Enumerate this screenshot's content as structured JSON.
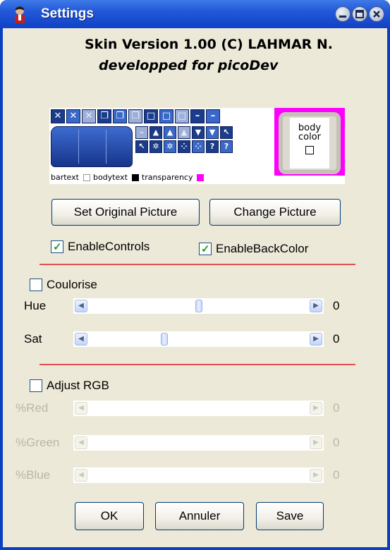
{
  "window": {
    "title": "Settings"
  },
  "header": {
    "skin_title": "Skin Version 1.00 (C)  LAHMAR N.",
    "skin_subtitle": "developped for picoDev"
  },
  "skin_preview": {
    "legend": [
      "bartext",
      "bodytext",
      "transparency"
    ],
    "legend_swatches": [
      "#ffffff",
      "#000000",
      "#ff00ff"
    ],
    "body_color_label_line1": "body",
    "body_color_label_line2": "color"
  },
  "buttons": {
    "set_original": "Set Original Picture",
    "change_picture": "Change Picture",
    "ok": "OK",
    "cancel": "Annuler",
    "save": "Save"
  },
  "options": {
    "enable_controls": {
      "label": "EnableControls",
      "checked": true
    },
    "enable_back_color": {
      "label": "EnableBackColor",
      "checked": true
    }
  },
  "coulorise": {
    "label": "Coulorise",
    "checked": false,
    "hue": {
      "label": "Hue",
      "value": "0",
      "position": 0.5
    },
    "sat": {
      "label": "Sat",
      "value": "0",
      "position": 0.34
    }
  },
  "rgb": {
    "label": "Adjust RGB",
    "checked": false,
    "red": {
      "label": "%Red",
      "value": "0"
    },
    "green": {
      "label": "%Green",
      "value": "0"
    },
    "blue": {
      "label": "%Blue",
      "value": "0"
    }
  },
  "colors": {
    "titlebar": "#2258d8",
    "separator": "#e05050",
    "face": "#ece9d8",
    "check": "#21a121"
  }
}
